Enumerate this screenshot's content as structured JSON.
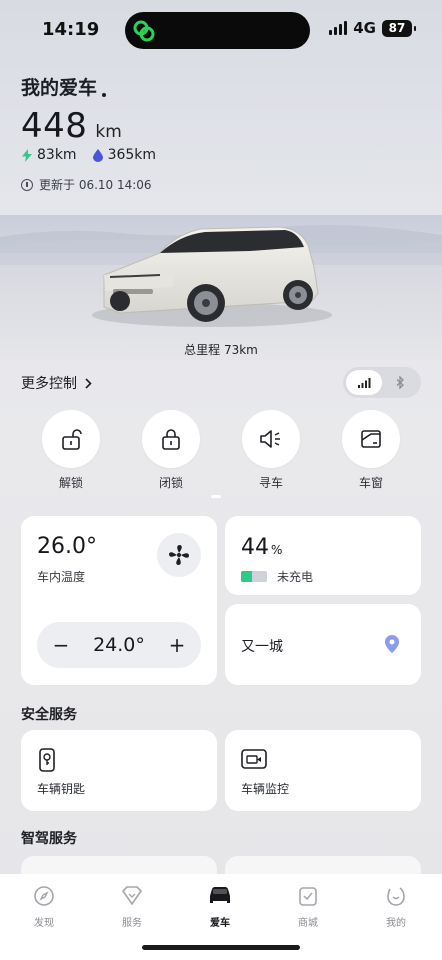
{
  "status_bar": {
    "time": "14:19",
    "network": "4G",
    "battery": "87"
  },
  "header": {
    "title": "我的爱车",
    "range_value": "448",
    "range_unit": "km",
    "electric_range": "83km",
    "fuel_range": "365km",
    "updated": "更新于 06.10 14:06"
  },
  "odometer": "总里程 73km",
  "more_control": {
    "label": "更多控制",
    "chevron": "chevron-right-icon"
  },
  "connection_toggle": {
    "options": [
      "signal-icon",
      "bluetooth-icon"
    ],
    "active": "signal-icon"
  },
  "controls": [
    {
      "label": "解锁",
      "icon": "unlock-icon"
    },
    {
      "label": "闭锁",
      "icon": "lock-icon"
    },
    {
      "label": "寻车",
      "icon": "horn-icon"
    },
    {
      "label": "车窗",
      "icon": "window-icon"
    }
  ],
  "climate": {
    "cabin_temp": "26.0°",
    "cabin_label": "车内温度",
    "target_temp": "24.0°",
    "minus": "−",
    "plus": "+"
  },
  "battery_card": {
    "percent": "44",
    "unit": "%",
    "level": 0.44,
    "status": "未充电"
  },
  "location": {
    "name": "又一城"
  },
  "safety": {
    "title": "安全服务",
    "items": [
      {
        "label": "车辆钥匙",
        "icon": "key-icon"
      },
      {
        "label": "车辆监控",
        "icon": "monitor-icon"
      }
    ]
  },
  "smart_drive": {
    "title": "智驾服务"
  },
  "tabs": [
    {
      "label": "发现",
      "icon": "compass-icon"
    },
    {
      "label": "服务",
      "icon": "heart-icon"
    },
    {
      "label": "爱车",
      "icon": "car-icon",
      "active": true
    },
    {
      "label": "商城",
      "icon": "bag-icon"
    },
    {
      "label": "我的",
      "icon": "profile-icon"
    }
  ],
  "colors": {
    "accent_green": "#2fc98c",
    "pin": "#8a9cf0"
  }
}
